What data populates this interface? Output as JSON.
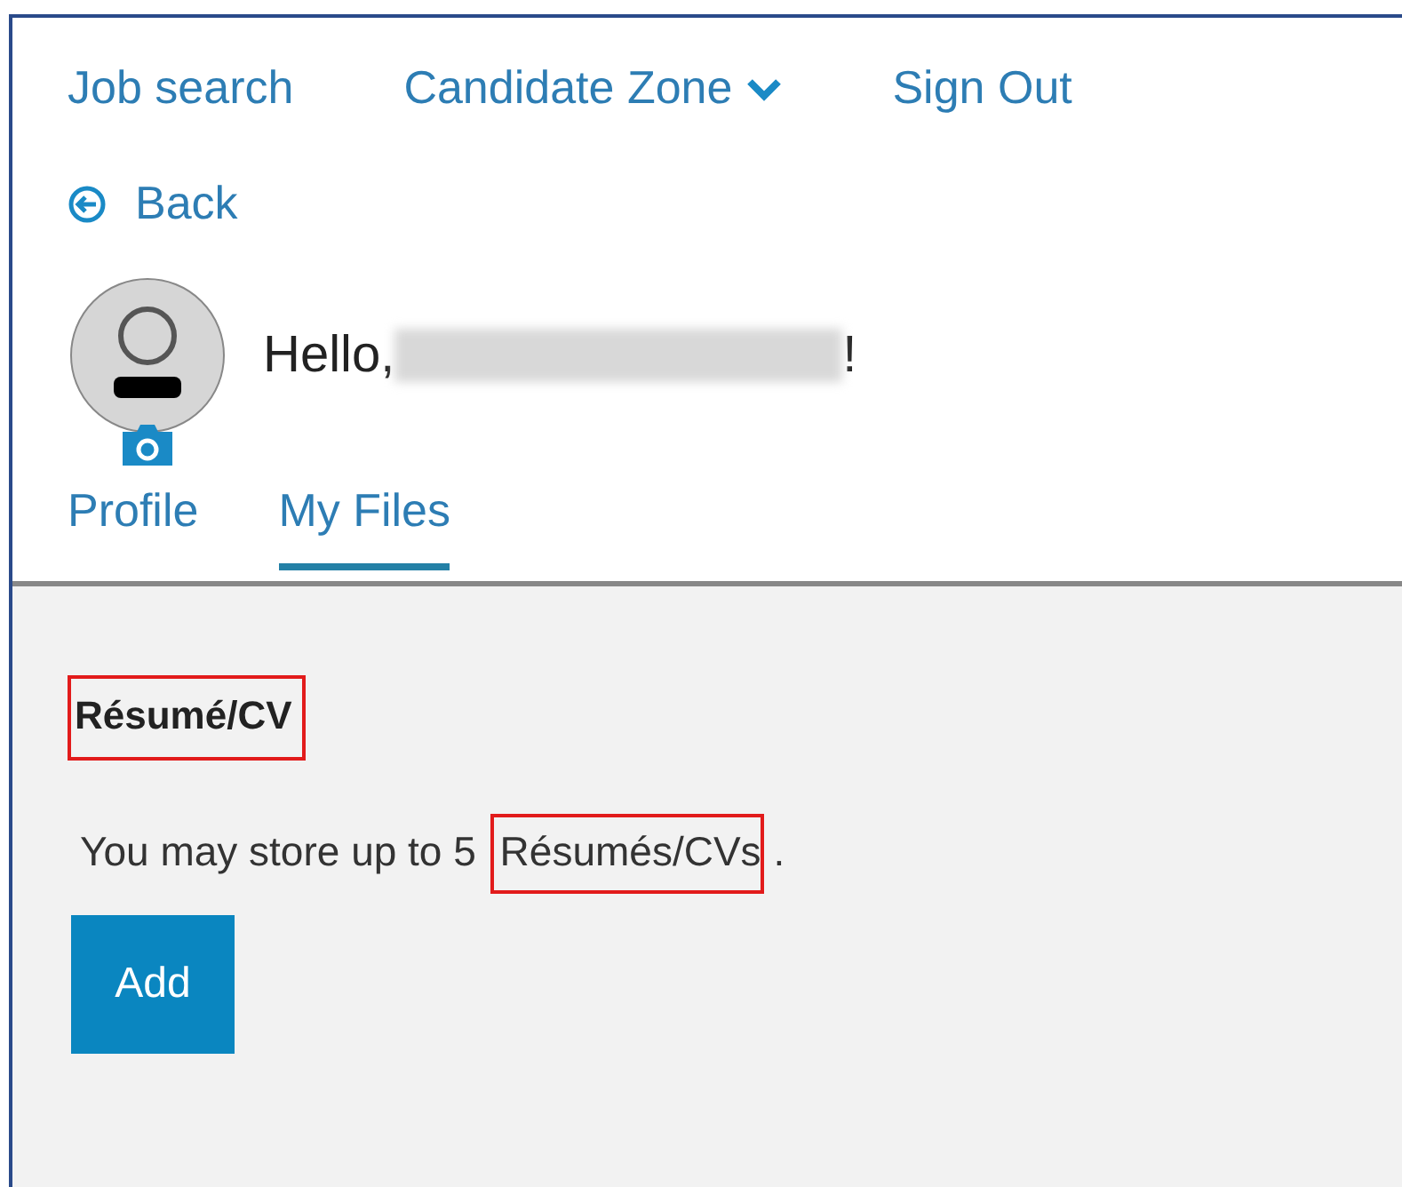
{
  "nav": [
    {
      "label": "Job search",
      "kind": "link"
    },
    {
      "label": "Candidate Zone",
      "kind": "dropdown"
    },
    {
      "label": "Sign Out",
      "kind": "link"
    }
  ],
  "back": {
    "label": "Back"
  },
  "greeting": {
    "prefix": "Hello, ",
    "name_blurred": true,
    "suffix": "!"
  },
  "tabs": [
    {
      "label": "Profile",
      "selected": false
    },
    {
      "label": "My Files",
      "selected": true
    }
  ],
  "section": {
    "heading": "Résumé/CV",
    "heading_highlighted": true,
    "text_parts": [
      {
        "text": "You may store up to 5 ",
        "highlighted": false
      },
      {
        "text": "Résumés/CVs",
        "highlighted": true
      },
      {
        "text": ".",
        "highlighted": false
      }
    ],
    "button": "Add"
  }
}
